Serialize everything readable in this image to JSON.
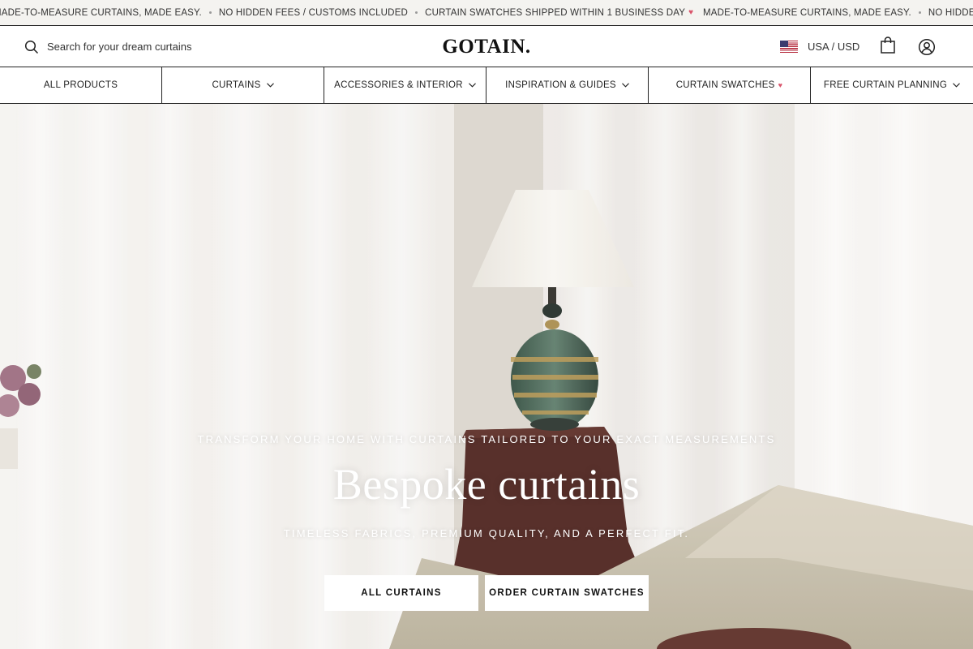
{
  "announcement": {
    "items": [
      "MADE-TO-MEASURE CURTAINS, MADE EASY.",
      "NO HIDDEN FEES / CUSTOMS INCLUDED",
      "CURTAIN SWATCHES SHIPPED WITHIN 1 BUSINESS DAY"
    ],
    "heart_icon": "heart-letter-icon"
  },
  "header": {
    "search": {
      "placeholder": "Search for your dream curtains",
      "icon": "search-icon"
    },
    "logo": "GOTAIN.",
    "locale": {
      "label": "USA / USD",
      "flag_icon": "us-flag-icon"
    },
    "cart_icon": "shopping-bag-icon",
    "account_icon": "account-icon"
  },
  "nav": {
    "items": [
      {
        "label": "ALL PRODUCTS"
      },
      {
        "label": "CURTAINS"
      },
      {
        "label": "ACCESSORIES & INTERIOR"
      },
      {
        "label": "INSPIRATION & GUIDES"
      },
      {
        "label": "CURTAIN SWATCHES"
      },
      {
        "label": "FREE CURTAIN PLANNING"
      }
    ]
  },
  "hero": {
    "eyebrow": "TRANSFORM YOUR HOME WITH CURTAINS TAILORED TO YOUR EXACT MEASUREMENTS",
    "headline": "Bespoke curtains",
    "subheadline": "TIMELESS FABRICS, PREMIUM QUALITY, AND A PERFECT FIT.",
    "primary_button": "ALL CURTAINS",
    "secondary_button": "ORDER CURTAIN SWATCHES"
  },
  "colors": {
    "border": "#222222",
    "announcement_bg": "#f4f3f0",
    "heart": "#d9536a",
    "hero_text": "#ffffff",
    "button_bg": "#ffffff"
  }
}
